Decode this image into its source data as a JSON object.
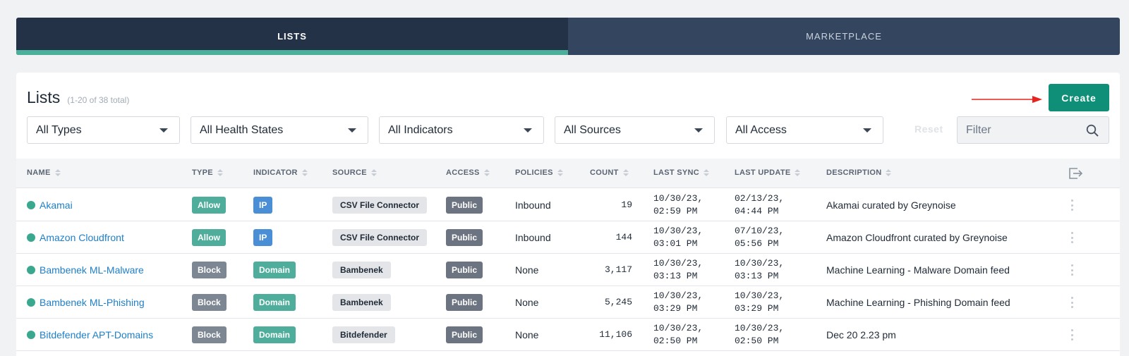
{
  "tabs": [
    {
      "label": "LISTS",
      "active": true
    },
    {
      "label": "MARKETPLACE",
      "active": false
    }
  ],
  "header": {
    "title": "Lists",
    "subtitle": "(1-20 of 38 total)",
    "create_label": "Create"
  },
  "filters": {
    "types": "All Types",
    "health": "All Health States",
    "indicators": "All Indicators",
    "sources": "All Sources",
    "access": "All Access",
    "reset_label": "Reset",
    "filter_placeholder": "Filter"
  },
  "columns": {
    "name": "NAME",
    "type": "TYPE",
    "indicator": "INDICATOR",
    "source": "SOURCE",
    "access": "ACCESS",
    "policies": "POLICIES",
    "count": "COUNT",
    "last_sync": "LAST SYNC",
    "last_update": "LAST UPDATE",
    "description": "DESCRIPTION"
  },
  "rows": [
    {
      "name": "Akamai",
      "type": "Allow",
      "indicator": "IP",
      "source": "CSV File Connector",
      "access": "Public",
      "policies": "Inbound",
      "count": "19",
      "sync1": "10/30/23,",
      "sync2": "02:59 PM",
      "upd1": "02/13/23,",
      "upd2": "04:44 PM",
      "description": "Akamai curated by Greynoise"
    },
    {
      "name": "Amazon Cloudfront",
      "type": "Allow",
      "indicator": "IP",
      "source": "CSV File Connector",
      "access": "Public",
      "policies": "Inbound",
      "count": "144",
      "sync1": "10/30/23,",
      "sync2": "03:01 PM",
      "upd1": "07/10/23,",
      "upd2": "05:56 PM",
      "description": "Amazon Cloudfront curated by Greynoise"
    },
    {
      "name": "Bambenek ML-Malware",
      "type": "Block",
      "indicator": "Domain",
      "source": "Bambenek",
      "access": "Public",
      "policies": "None",
      "count": "3,117",
      "sync1": "10/30/23,",
      "sync2": "03:13 PM",
      "upd1": "10/30/23,",
      "upd2": "03:13 PM",
      "description": "Machine Learning - Malware Domain feed"
    },
    {
      "name": "Bambenek ML-Phishing",
      "type": "Block",
      "indicator": "Domain",
      "source": "Bambenek",
      "access": "Public",
      "policies": "None",
      "count": "5,245",
      "sync1": "10/30/23,",
      "sync2": "03:29 PM",
      "upd1": "10/30/23,",
      "upd2": "03:29 PM",
      "description": "Machine Learning - Phishing Domain feed"
    },
    {
      "name": "Bitdefender APT-Domains",
      "type": "Block",
      "indicator": "Domain",
      "source": "Bitdefender",
      "access": "Public",
      "policies": "None",
      "count": "11,106",
      "sync1": "10/30/23,",
      "sync2": "02:50 PM",
      "upd1": "10/30/23,",
      "upd2": "02:50 PM",
      "description": "Dec 20 2.23 pm"
    }
  ],
  "colors": {
    "accent": "#0f8f78",
    "tab_active": "#243248",
    "tab_inactive": "#34465f",
    "link": "#1e7fc9"
  },
  "icons": {
    "search": "search-icon",
    "export": "export-icon",
    "row_menu": "kebab-menu-icon",
    "status": "status-dot-icon"
  }
}
